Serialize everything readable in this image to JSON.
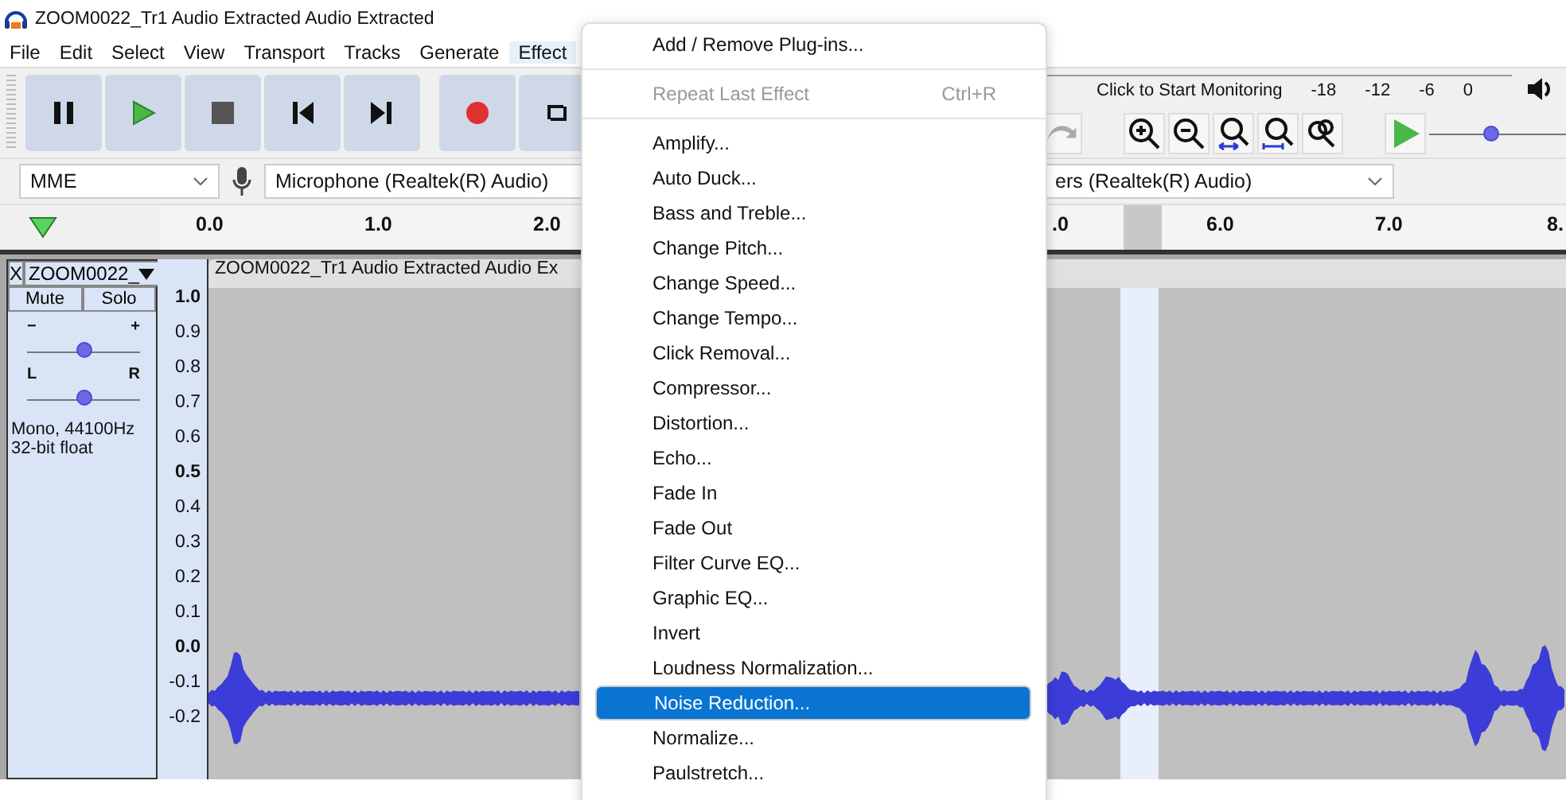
{
  "window": {
    "title": "ZOOM0022_Tr1 Audio Extracted Audio Extracted"
  },
  "menu_bar": [
    {
      "label": "File",
      "selected": false
    },
    {
      "label": "Edit",
      "selected": false
    },
    {
      "label": "Select",
      "selected": false
    },
    {
      "label": "View",
      "selected": false
    },
    {
      "label": "Transport",
      "selected": false
    },
    {
      "label": "Tracks",
      "selected": false
    },
    {
      "label": "Generate",
      "selected": false
    },
    {
      "label": "Effect",
      "selected": true
    }
  ],
  "transport": [
    {
      "kind": "pause"
    },
    {
      "kind": "play"
    },
    {
      "kind": "stop"
    },
    {
      "kind": "skip-start"
    },
    {
      "kind": "skip-end"
    },
    {
      "kind": "record"
    },
    {
      "kind": "loop"
    }
  ],
  "meter": {
    "label": "Click to Start Monitoring",
    "ticks": [
      "-18",
      "-12",
      "-6",
      "0"
    ]
  },
  "play_at_speed": {
    "level": 0.45
  },
  "devices": {
    "host": "MME",
    "recording": "Microphone (Realtek(R) Audio)",
    "playback": "ers (Realtek(R) Audio)"
  },
  "ruler": {
    "labels": [
      "0.0",
      "1.0",
      "2.0",
      ".0",
      "6.0",
      "7.0",
      "8."
    ]
  },
  "track": {
    "close": "X",
    "name": "ZOOM0022_",
    "mute": "Mute",
    "solo": "Solo",
    "gain": {
      "minus": "−",
      "plus": "+",
      "level": 0.5
    },
    "pan": {
      "left": "L",
      "right": "R",
      "level": 0.5
    },
    "info": [
      "Mono, 44100Hz",
      "32-bit float"
    ],
    "scale": [
      {
        "text": "1.0",
        "bold": true
      },
      {
        "text": "0.9",
        "bold": false
      },
      {
        "text": "0.8",
        "bold": false
      },
      {
        "text": "0.7",
        "bold": false
      },
      {
        "text": "0.6",
        "bold": false
      },
      {
        "text": "0.5",
        "bold": true
      },
      {
        "text": "0.4",
        "bold": false
      },
      {
        "text": "0.3",
        "bold": false
      },
      {
        "text": "0.2",
        "bold": false
      },
      {
        "text": "0.1",
        "bold": false
      },
      {
        "text": "0.0",
        "bold": true
      },
      {
        "text": "-0.1",
        "bold": false
      },
      {
        "text": "-0.2",
        "bold": false
      }
    ],
    "clip_title": "ZOOM0022_Tr1 Audio Extracted Audio Ex"
  },
  "effect_menu": [
    {
      "kind": "item",
      "label": "Add / Remove Plug-ins...",
      "disabled": false,
      "selected": false
    },
    {
      "kind": "separator"
    },
    {
      "kind": "item",
      "label": "Repeat Last Effect",
      "shortcut": "Ctrl+R",
      "disabled": true,
      "selected": false
    },
    {
      "kind": "separator"
    },
    {
      "kind": "item",
      "label": "Amplify...",
      "disabled": false,
      "selected": false
    },
    {
      "kind": "item",
      "label": "Auto Duck...",
      "disabled": false,
      "selected": false
    },
    {
      "kind": "item",
      "label": "Bass and Treble...",
      "disabled": false,
      "selected": false
    },
    {
      "kind": "item",
      "label": "Change Pitch...",
      "disabled": false,
      "selected": false
    },
    {
      "kind": "item",
      "label": "Change Speed...",
      "disabled": false,
      "selected": false
    },
    {
      "kind": "item",
      "label": "Change Tempo...",
      "disabled": false,
      "selected": false
    },
    {
      "kind": "item",
      "label": "Click Removal...",
      "disabled": false,
      "selected": false
    },
    {
      "kind": "item",
      "label": "Compressor...",
      "disabled": false,
      "selected": false
    },
    {
      "kind": "item",
      "label": "Distortion...",
      "disabled": false,
      "selected": false
    },
    {
      "kind": "item",
      "label": "Echo...",
      "disabled": false,
      "selected": false
    },
    {
      "kind": "item",
      "label": "Fade In",
      "disabled": false,
      "selected": false
    },
    {
      "kind": "item",
      "label": "Fade Out",
      "disabled": false,
      "selected": false
    },
    {
      "kind": "item",
      "label": "Filter Curve EQ...",
      "disabled": false,
      "selected": false
    },
    {
      "kind": "item",
      "label": "Graphic EQ...",
      "disabled": false,
      "selected": false
    },
    {
      "kind": "item",
      "label": "Invert",
      "disabled": false,
      "selected": false
    },
    {
      "kind": "item",
      "label": "Loudness Normalization...",
      "disabled": false,
      "selected": false
    },
    {
      "kind": "item",
      "label": "Noise Reduction...",
      "disabled": false,
      "selected": true
    },
    {
      "kind": "item",
      "label": "Normalize...",
      "disabled": false,
      "selected": false
    },
    {
      "kind": "item",
      "label": "Paulstretch...",
      "disabled": false,
      "selected": false
    }
  ]
}
